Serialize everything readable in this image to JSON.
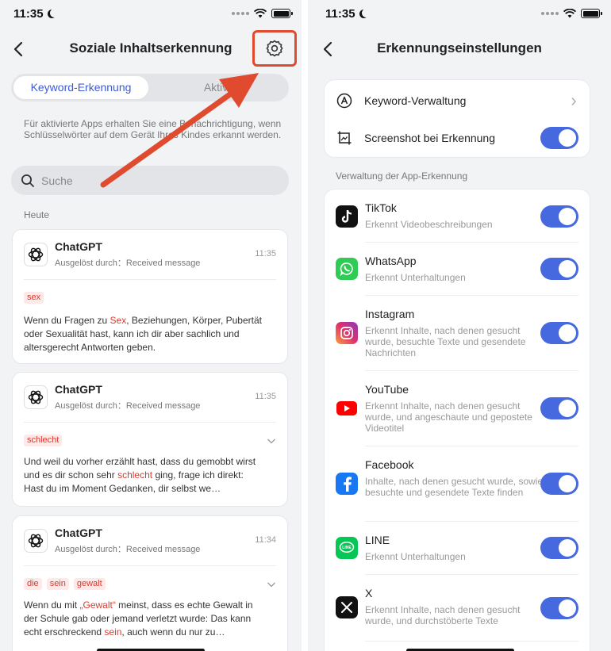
{
  "left": {
    "status_time": "11:35",
    "title": "Soziale Inhaltserkennung",
    "tabs": [
      {
        "label": "Keyword-Erkennung"
      },
      {
        "label": "Aktivit"
      }
    ],
    "info_text": "Für aktivierte Apps erhalten Sie eine Benachrichtigung, wenn Schlüsselwörter auf dem Gerät Ihres Kindes erkannt werden.",
    "search_placeholder": "Suche",
    "section": "Heute",
    "cards": [
      {
        "app": "ChatGPT",
        "trigger": "Ausgelöst durch：Received message",
        "time": "11:35",
        "tags": [
          "sex"
        ],
        "msg_parts": [
          {
            "t": "Wenn du Fragen zu ",
            "hl": false
          },
          {
            "t": "Sex",
            "hl": true
          },
          {
            "t": ", Beziehungen, Körper, Pubertät oder Sexualität hast, kann ich dir aber sachlich und altersgerecht Antworten geben.",
            "hl": false
          }
        ]
      },
      {
        "app": "ChatGPT",
        "trigger": "Ausgelöst durch：Received message",
        "time": "11:35",
        "tags": [
          "schlecht"
        ],
        "msg_parts": [
          {
            "t": "Und weil du vorher erzählt hast, dass du gemobbt wirst und es dir schon sehr ",
            "hl": false
          },
          {
            "t": "schlecht",
            "hl": true
          },
          {
            "t": " ging, frage ich direkt: Hast du im Moment Gedanken, dir selbst we…",
            "hl": false
          }
        ]
      },
      {
        "app": "ChatGPT",
        "trigger": "Ausgelöst durch：Received message",
        "time": "11:34",
        "tags": [
          "die",
          "sein",
          "gewalt"
        ],
        "msg_parts": [
          {
            "t": "Wenn du mit ",
            "hl": false
          },
          {
            "t": "„Gewalt“",
            "hl": true
          },
          {
            "t": " meinst, dass es echte Gewalt in der Schule gab oder jemand verletzt wurde: Das kann echt erschreckend ",
            "hl": false
          },
          {
            "t": "sein",
            "hl": true
          },
          {
            "t": ", auch wenn du nur zu…",
            "hl": false
          }
        ]
      }
    ]
  },
  "right": {
    "status_time": "11:35",
    "title": "Erkennungseinstellungen",
    "keyword_mgmt": "Keyword-Verwaltung",
    "screenshot_label": "Screenshot bei Erkennung",
    "screenshot_on": true,
    "section": "Verwaltung der App-Erkennung",
    "apps": [
      {
        "name": "TikTok",
        "desc": "Erkennt Videobeschreibungen",
        "on": true,
        "color": "#111111",
        "icon": "tiktok-icon"
      },
      {
        "name": "WhatsApp",
        "desc": "Erkennt Unterhaltungen",
        "on": true,
        "color": "#2ecc55",
        "icon": "whatsapp-icon"
      },
      {
        "name": "Instagram",
        "desc": "Erkennt Inhalte, nach denen gesucht wurde, besuchte Texte und gesendete Nachrichten",
        "on": true,
        "color": "#e1306c",
        "icon": "instagram-icon"
      },
      {
        "name": "YouTube",
        "desc": "Erkennt Inhalte, nach denen gesucht wurde, und angeschaute und gepostete Videotitel",
        "on": true,
        "color": "#ff0000",
        "icon": "youtube-icon"
      },
      {
        "name": "Facebook",
        "desc": "Inhalte, nach denen gesucht wurde, sowie besuchte und gesendete Texte finden",
        "on": true,
        "color": "#1877f2",
        "icon": "facebook-icon"
      },
      {
        "name": "LINE",
        "desc": "Erkennt Unterhaltungen",
        "on": true,
        "color": "#06c755",
        "icon": "line-icon"
      },
      {
        "name": "X",
        "desc": "Erkennt Inhalte, nach denen gesucht wurde, und durchstöberte Texte",
        "on": true,
        "color": "#111111",
        "icon": "x-icon"
      }
    ]
  },
  "colors": {
    "accent": "#4769e0",
    "highlight": "#d93b30",
    "annotation": "#e04a2e"
  }
}
